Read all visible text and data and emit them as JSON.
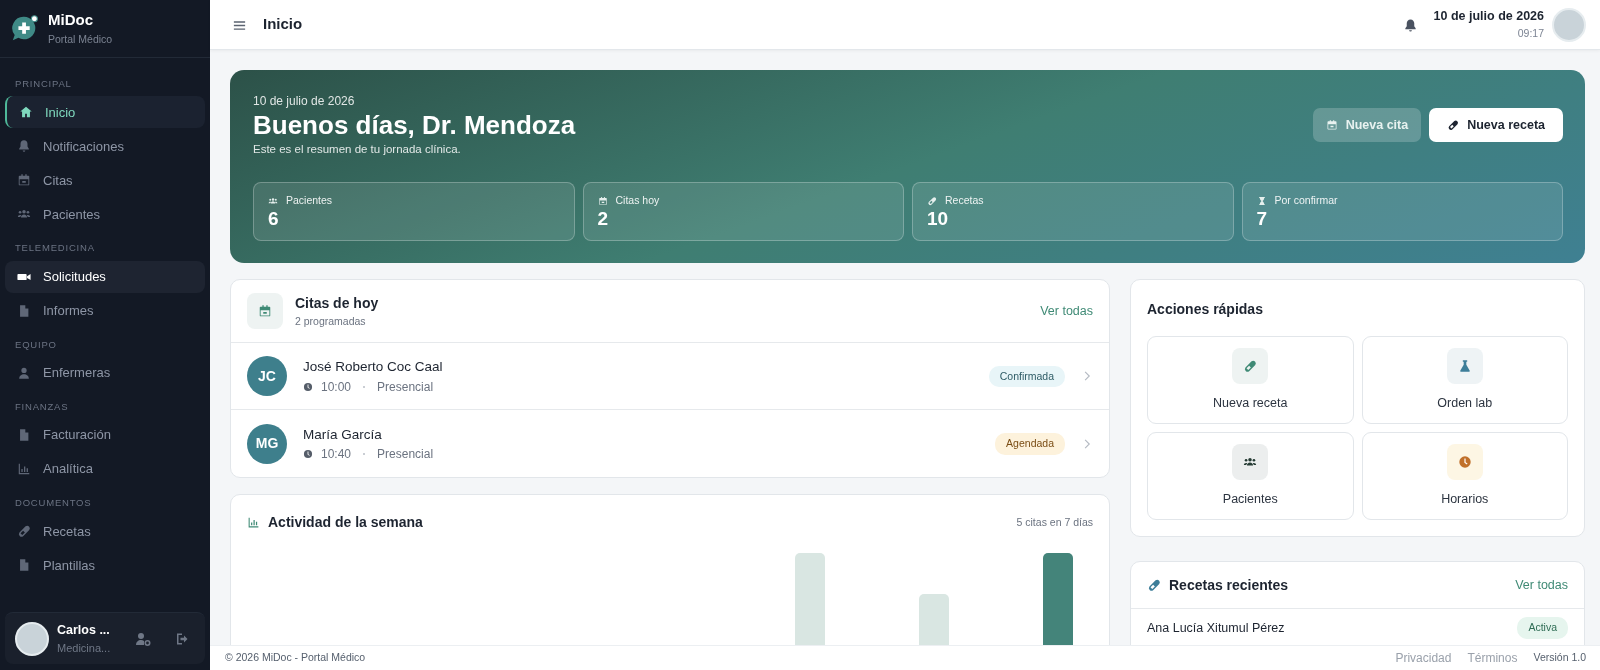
{
  "brand": {
    "name": "MiDoc",
    "subtitle": "Portal Médico"
  },
  "sidebar": {
    "sections": [
      {
        "title": "PRINCIPAL",
        "items": [
          {
            "label": "Inicio",
            "selected": true,
            "hovered": false
          },
          {
            "label": "Notificaciones",
            "selected": false,
            "hovered": false
          },
          {
            "label": "Citas",
            "selected": false,
            "hovered": false
          },
          {
            "label": "Pacientes",
            "selected": false,
            "hovered": false
          }
        ]
      },
      {
        "title": "TELEMEDICINA",
        "items": [
          {
            "label": "Solicitudes",
            "selected": false,
            "hovered": true
          },
          {
            "label": "Informes",
            "selected": false,
            "hovered": false
          }
        ]
      },
      {
        "title": "EQUIPO",
        "items": [
          {
            "label": "Enfermeras",
            "selected": false,
            "hovered": false
          }
        ]
      },
      {
        "title": "FINANZAS",
        "items": [
          {
            "label": "Facturación",
            "selected": false,
            "hovered": false
          },
          {
            "label": "Analítica",
            "selected": false,
            "hovered": false
          }
        ]
      },
      {
        "title": "DOCUMENTOS",
        "items": [
          {
            "label": "Recetas",
            "selected": false,
            "hovered": false
          },
          {
            "label": "Plantillas",
            "selected": false,
            "hovered": false
          }
        ]
      }
    ]
  },
  "user": {
    "name": "Carlos ...",
    "role": "Medicina..."
  },
  "header": {
    "title": "Inicio",
    "date": "10 de julio de 2026",
    "time": "09:17"
  },
  "hero": {
    "date": "10 de julio de 2026",
    "greeting": "Buenos días, Dr. Mendoza",
    "subtitle": "Este es el resumen de tu jornada clínica.",
    "buttons": [
      {
        "label": "Nueva cita",
        "kind": "secondary"
      },
      {
        "label": "Nueva receta",
        "kind": "primary"
      }
    ],
    "stats": [
      {
        "label": "Pacientes",
        "value": "6"
      },
      {
        "label": "Citas hoy",
        "value": "2"
      },
      {
        "label": "Recetas",
        "value": "10"
      },
      {
        "label": "Por confirmar",
        "value": "7"
      }
    ]
  },
  "appointments": {
    "title": "Citas de hoy",
    "subtitle": "2 programadas",
    "link": "Ver todas",
    "rows": [
      {
        "initials": "JC",
        "name": "José Roberto Coc Caal",
        "time": "10:00",
        "mode": "Presencial",
        "status": "Confirmada",
        "kind": "confirmed"
      },
      {
        "initials": "MG",
        "name": "María García",
        "time": "10:40",
        "mode": "Presencial",
        "status": "Agendada",
        "kind": "scheduled"
      }
    ]
  },
  "activity": {
    "title": "Actividad de la semana",
    "summary": "5 citas en 7 días"
  },
  "quick_actions": {
    "title": "Acciones rápidas",
    "items": [
      {
        "label": "Nueva receta"
      },
      {
        "label": "Orden lab"
      },
      {
        "label": "Pacientes"
      },
      {
        "label": "Horarios"
      }
    ]
  },
  "recent_prescriptions": {
    "title": "Recetas recientes",
    "link": "Ver todas",
    "rows": [
      {
        "patient": "Ana Lucía Xitumul Pérez",
        "status": "Activa"
      }
    ]
  },
  "footer": {
    "copyright": "© 2026 MiDoc - Portal Médico",
    "links": [
      "Privacidad",
      "Términos"
    ],
    "version": "Versión 1.0"
  }
}
